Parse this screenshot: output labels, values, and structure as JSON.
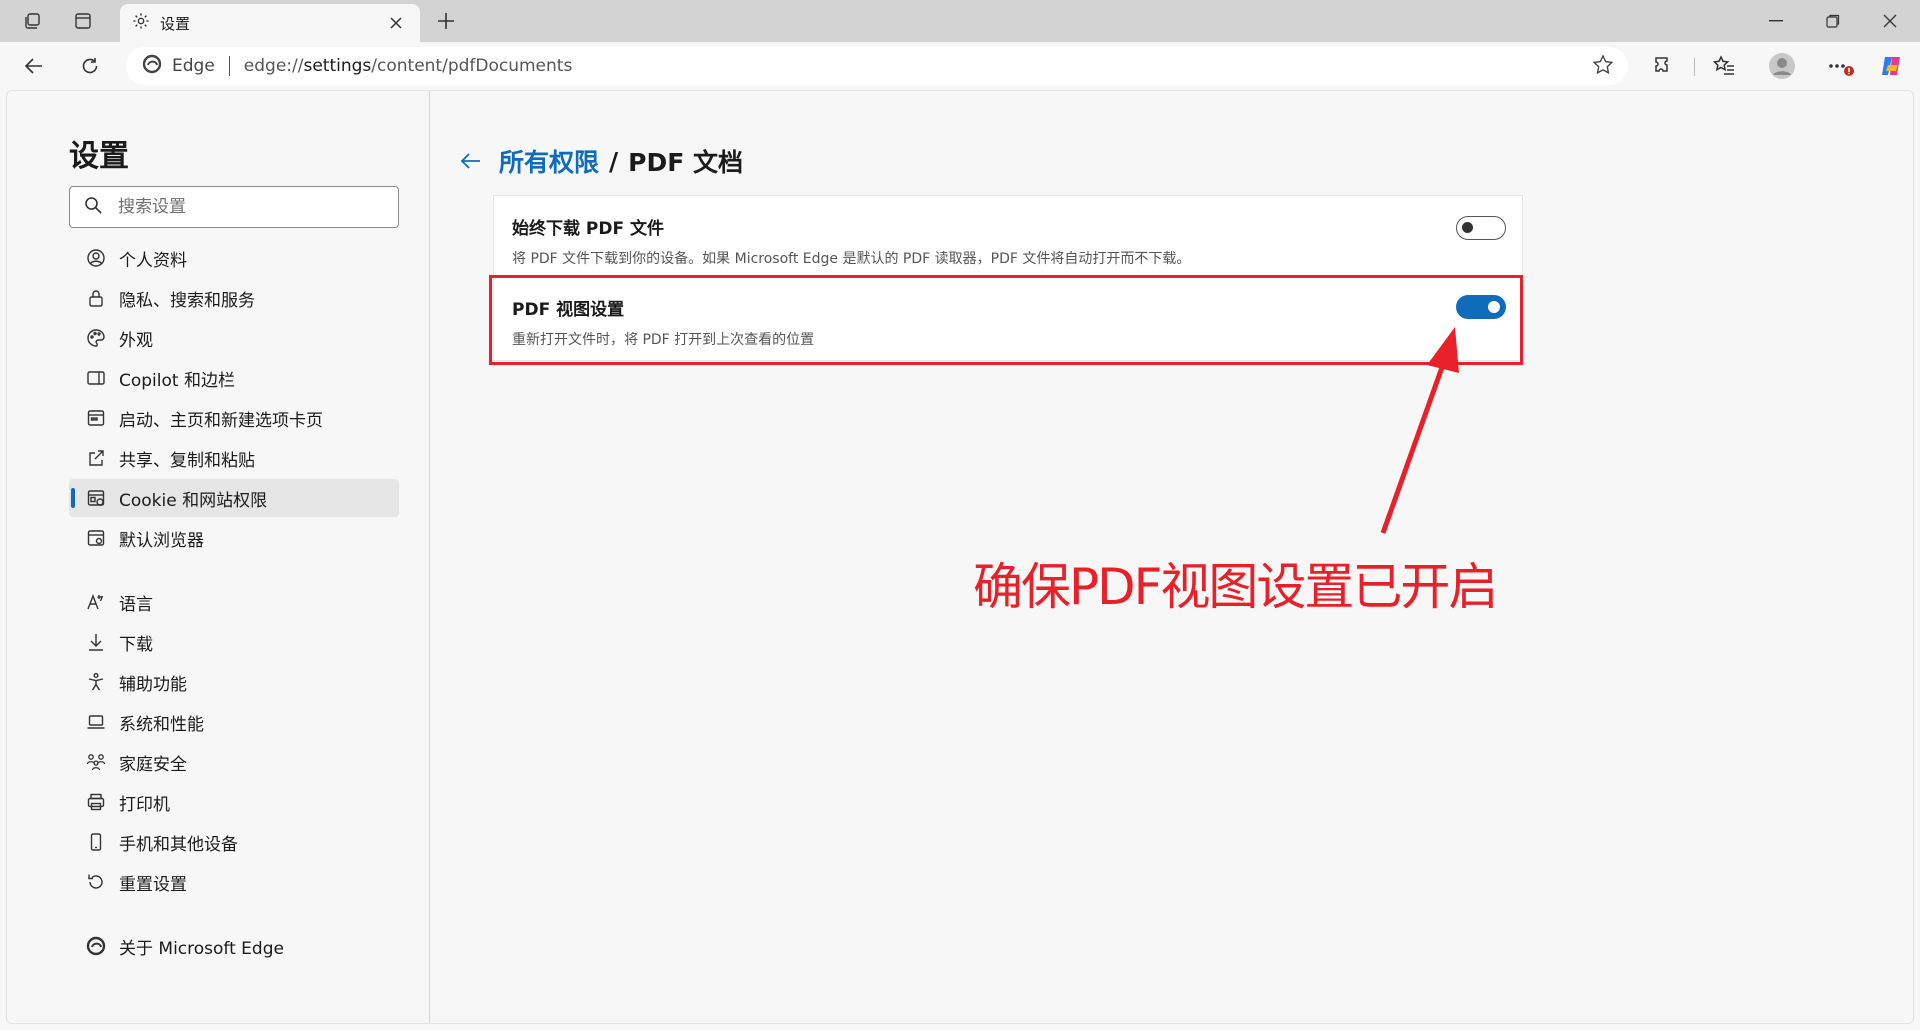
{
  "browser": {
    "tab_title": "设置",
    "site_name": "Edge",
    "url_prefix": "edge://",
    "url_host": "settings",
    "url_path": "/content/pdfDocuments"
  },
  "sidebar": {
    "title": "设置",
    "search_placeholder": "搜索设置",
    "items": [
      {
        "label": "个人资料",
        "icon": "profile-icon"
      },
      {
        "label": "隐私、搜索和服务",
        "icon": "lock-icon"
      },
      {
        "label": "外观",
        "icon": "palette-icon"
      },
      {
        "label": "Copilot 和边栏",
        "icon": "sidebar-icon"
      },
      {
        "label": "启动、主页和新建选项卡页",
        "icon": "home-grid-icon"
      },
      {
        "label": "共享、复制和粘贴",
        "icon": "share-icon"
      },
      {
        "label": "Cookie 和网站权限",
        "icon": "site-permissions-icon",
        "active": true
      },
      {
        "label": "默认浏览器",
        "icon": "default-browser-icon"
      },
      {
        "label": "语言",
        "icon": "language-icon"
      },
      {
        "label": "下载",
        "icon": "download-icon"
      },
      {
        "label": "辅助功能",
        "icon": "accessibility-icon"
      },
      {
        "label": "系统和性能",
        "icon": "laptop-icon"
      },
      {
        "label": "家庭安全",
        "icon": "family-icon"
      },
      {
        "label": "打印机",
        "icon": "printer-icon"
      },
      {
        "label": "手机和其他设备",
        "icon": "phone-icon"
      },
      {
        "label": "重置设置",
        "icon": "reset-icon"
      },
      {
        "label": "关于 Microsoft Edge",
        "icon": "edge-logo-icon"
      }
    ]
  },
  "main": {
    "breadcrumb_link": "所有权限",
    "breadcrumb_sep": "/",
    "breadcrumb_current": "PDF 文档",
    "settings": [
      {
        "title": "始终下载 PDF 文件",
        "desc": "将 PDF 文件下载到你的设备。如果 Microsoft Edge 是默认的 PDF 读取器，PDF 文件将自动打开而不下载。",
        "enabled": false
      },
      {
        "title": "PDF 视图设置",
        "desc": "重新打开文件时，将 PDF 打开到上次查看的位置",
        "enabled": true
      }
    ]
  },
  "annotation": {
    "text": "确保PDF视图设置已开启",
    "color": "#e8202a"
  },
  "colors": {
    "accent": "#0f6cbd",
    "highlight": "#e8202a"
  }
}
